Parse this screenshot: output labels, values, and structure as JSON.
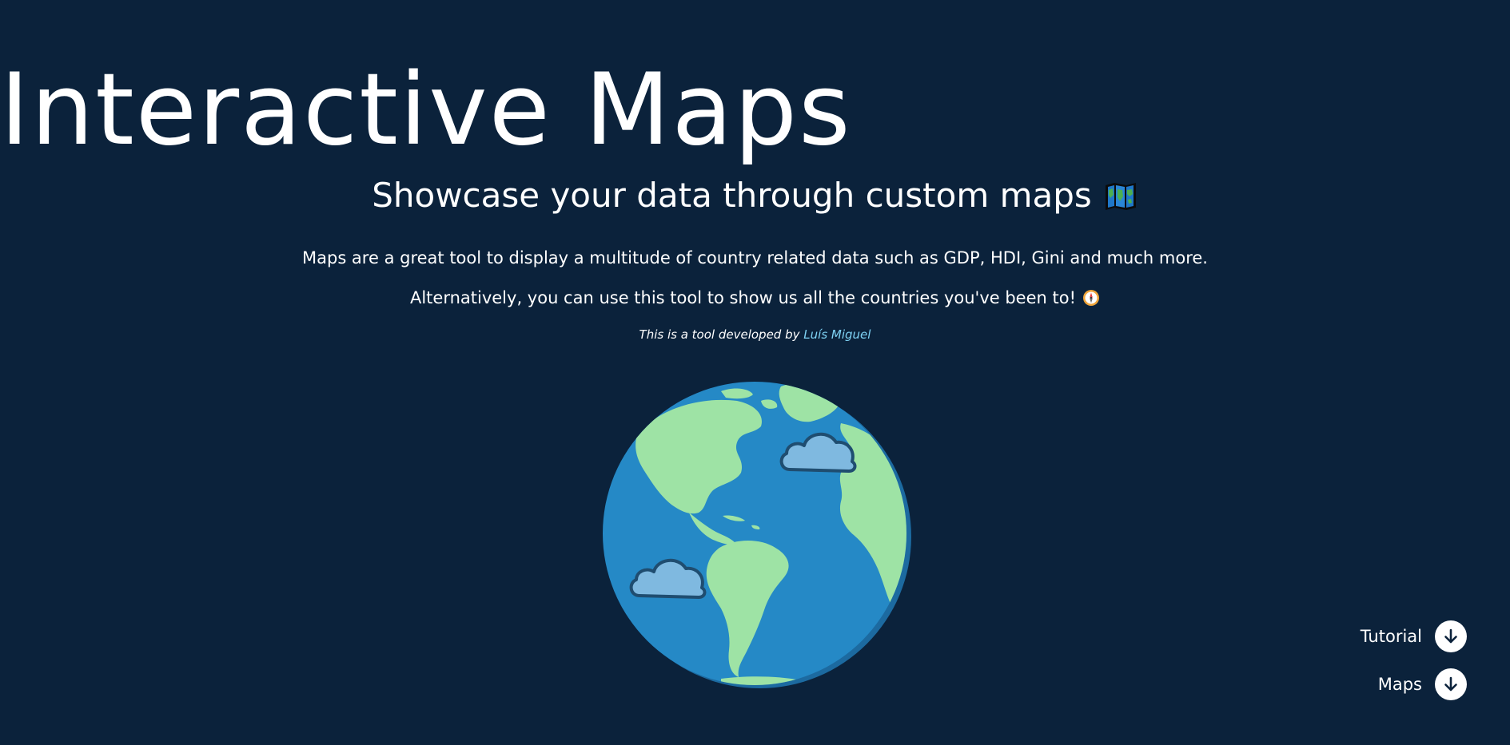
{
  "hero": {
    "title": "Interactive Maps",
    "subtitle": "Showcase your data through custom maps",
    "subtitle_icon": "world-map-icon",
    "description": "Maps are a great tool to display a multitude of country related data such as GDP, HDI, Gini and much more.",
    "alternative": "Alternatively, you can use this tool to show us all the countries you've been to!",
    "alternative_icon": "compass-icon",
    "credit_prefix": "This is a tool developed by",
    "credit_author": "Luís Miguel"
  },
  "illustration": {
    "icon": "globe-with-clouds-icon"
  },
  "nav": {
    "tutorial_label": "Tutorial",
    "maps_label": "Maps",
    "button_icon": "arrow-down-icon"
  },
  "colors": {
    "background": "#0b223b",
    "ocean": "#2589c6",
    "land": "#9ee3a5",
    "cloud": "#7fb9e0",
    "link": "#7fd3f5"
  }
}
